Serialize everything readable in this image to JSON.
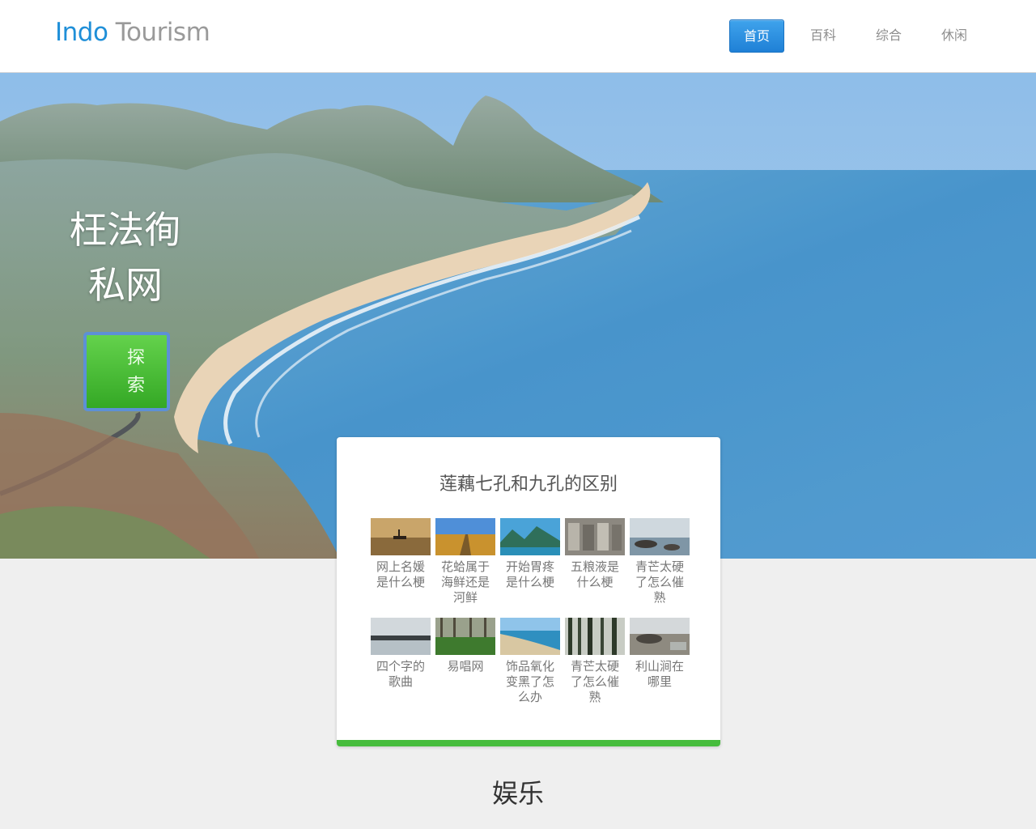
{
  "header": {
    "logo_part1": "Indo",
    "logo_part2": "Tourism",
    "nav": [
      {
        "label": "首页",
        "active": true
      },
      {
        "label": "百科",
        "active": false
      },
      {
        "label": "综合",
        "active": false
      },
      {
        "label": "休闲",
        "active": false
      }
    ]
  },
  "hero": {
    "title": "枉法徇私网",
    "button_label": "探索",
    "image": "coastal-beach-landscape"
  },
  "card": {
    "title": "莲藕七孔和九孔的区别",
    "items": [
      {
        "caption": "网上名媛是什么梗",
        "thumb": "boat-at-sunset"
      },
      {
        "caption": "花蛤属于海鲜还是河鲜",
        "thumb": "desert-road"
      },
      {
        "caption": "开始胃疼是什么梗",
        "thumb": "mountain-lake"
      },
      {
        "caption": "五粮液是什么梗",
        "thumb": "stone-relief"
      },
      {
        "caption": "青芒太硬了怎么催熟",
        "thumb": "rocky-seashore"
      },
      {
        "caption": "四个字的歌曲",
        "thumb": "misty-lake"
      },
      {
        "caption": "易唱网",
        "thumb": "forest-meadow"
      },
      {
        "caption": "饰品氧化变黑了怎么办",
        "thumb": "coastline"
      },
      {
        "caption": "青芒太硬了怎么催熟",
        "thumb": "pine-forest"
      },
      {
        "caption": "利山涧在哪里",
        "thumb": "rocky-shore"
      }
    ]
  },
  "section": {
    "title": "娱乐"
  },
  "colors": {
    "brand_blue": "#1f8fd8",
    "nav_active": "#2b8fe0",
    "button_green": "#46bc3c",
    "card_accent": "#46bc3c"
  }
}
